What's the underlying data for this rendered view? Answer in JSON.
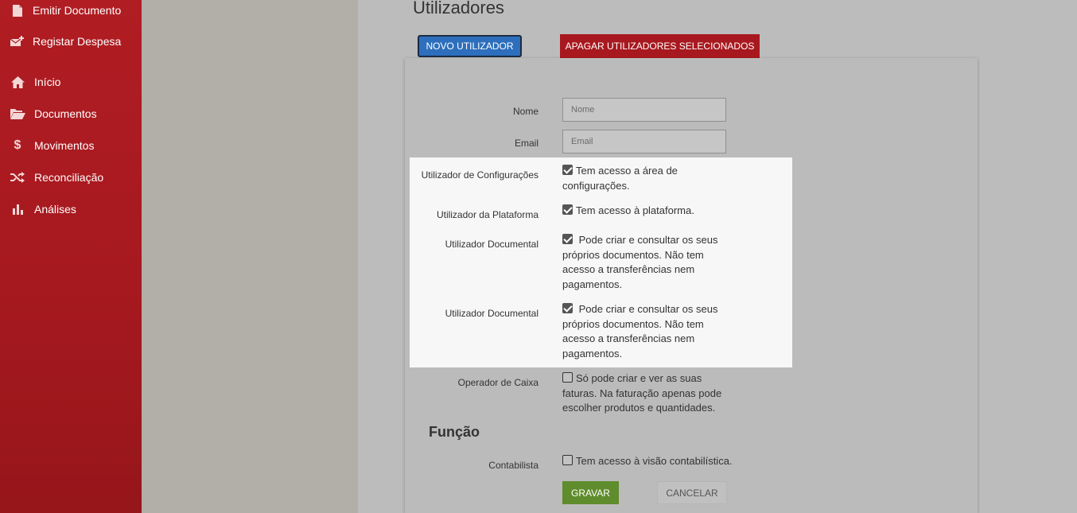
{
  "sidebar": {
    "items": [
      {
        "label": "Emitir Documento",
        "icon": "file-icon"
      },
      {
        "label": "Registar Despesa",
        "icon": "envelope-plus-icon"
      },
      {
        "label": "Início",
        "icon": "home-icon"
      },
      {
        "label": "Documentos",
        "icon": "folder-open-icon"
      },
      {
        "label": "Movimentos",
        "icon": "dollar-icon"
      },
      {
        "label": "Reconciliação",
        "icon": "shuffle-icon"
      },
      {
        "label": "Análises",
        "icon": "bar-chart-icon"
      }
    ]
  },
  "header": {
    "title": "Utilizadores",
    "new_user_label": "NOVO UTILIZADOR",
    "delete_selected_label": "APAGAR UTILIZADORES SELECIONADOS"
  },
  "form": {
    "name": {
      "label": "Nome",
      "placeholder": "Nome",
      "value": ""
    },
    "email": {
      "label": "Email",
      "placeholder": "Email",
      "value": ""
    },
    "roles": [
      {
        "label": "Utilizador de Configurações",
        "text": "Tem acesso a área de configurações.",
        "checked": true
      },
      {
        "label": "Utilizador da Plataforma",
        "text": "Tem acesso à plataforma.",
        "checked": true
      },
      {
        "label": "Utilizador Documental",
        "text": " Pode criar e consultar os seus próprios documentos. Não tem acesso a transferências nem pagamentos.",
        "checked": true
      },
      {
        "label": "Utilizador Documental",
        "text": " Pode criar e consultar os seus próprios documentos. Não tem acesso a transferências nem pagamentos.",
        "checked": true
      },
      {
        "label": "Operador de Caixa",
        "text": "Só pode criar e ver as suas faturas. Na faturação apenas pode escolher produtos e quantidades.",
        "checked": false
      }
    ],
    "function_title": "Função",
    "function": {
      "label": "Contabilista",
      "text": "Tem acesso à visão contabilística.",
      "checked": false
    },
    "save_label": "GRAVAR",
    "cancel_label": "CANCELAR"
  },
  "colors": {
    "sidebar": "#a6191f",
    "primary": "#2d6fbd",
    "danger": "#a8191f",
    "success": "#5f8c2c"
  }
}
